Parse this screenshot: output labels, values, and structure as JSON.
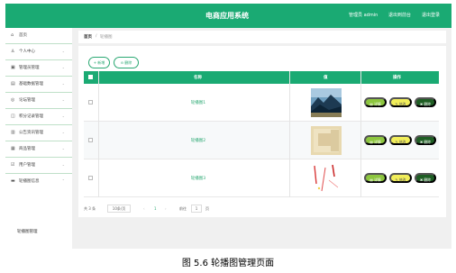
{
  "app_title": "电商应用系统",
  "topbar": {
    "admin_label": "管理员 admin",
    "front_link": "退出到前台",
    "logout_link": "退出登录"
  },
  "sidebar": {
    "items": [
      {
        "label": "首页",
        "icon": "home-icon"
      },
      {
        "label": "个人中心",
        "icon": "user-icon"
      },
      {
        "label": "管理员管理",
        "icon": "admin-icon"
      },
      {
        "label": "基础数据管理",
        "icon": "data-icon"
      },
      {
        "label": "论坛管理",
        "icon": "forum-icon"
      },
      {
        "label": "积分记录管理",
        "icon": "points-icon"
      },
      {
        "label": "公告资讯管理",
        "icon": "notice-icon"
      },
      {
        "label": "商品管理",
        "icon": "goods-icon"
      },
      {
        "label": "用户管理",
        "icon": "users-icon"
      },
      {
        "label": "轮播图信息",
        "icon": "carousel-icon"
      }
    ],
    "sub_item": "轮播图管理"
  },
  "breadcrumb": {
    "home": "首页",
    "separator": "/",
    "current": "轮播图"
  },
  "toolbar": {
    "add_label": "+ 新增",
    "delete_label": "⊖ 删除"
  },
  "table": {
    "columns": [
      "名称",
      "值",
      "操作"
    ],
    "rows": [
      {
        "name": "轮播图1",
        "image": "mountain-landscape"
      },
      {
        "name": "轮播图2",
        "image": "beige-book-cover"
      },
      {
        "name": "轮播图3",
        "image": "red-abstract-strokes"
      }
    ],
    "actions": {
      "detail": "详情",
      "edit": "修改",
      "delete": "删除"
    }
  },
  "pagination": {
    "total": "共 3 条",
    "page_size": "10条/页",
    "prev": "‹",
    "current_page": "1",
    "next": "›",
    "goto_label": "前往",
    "goto_value": "1",
    "page_unit": "页"
  },
  "caption": "图 5.6  轮播图管理页面",
  "colors": {
    "accent": "#1aaa73",
    "detail": "#8dc63f",
    "edit": "#f1ee5a",
    "delete": "#1f5e24"
  }
}
